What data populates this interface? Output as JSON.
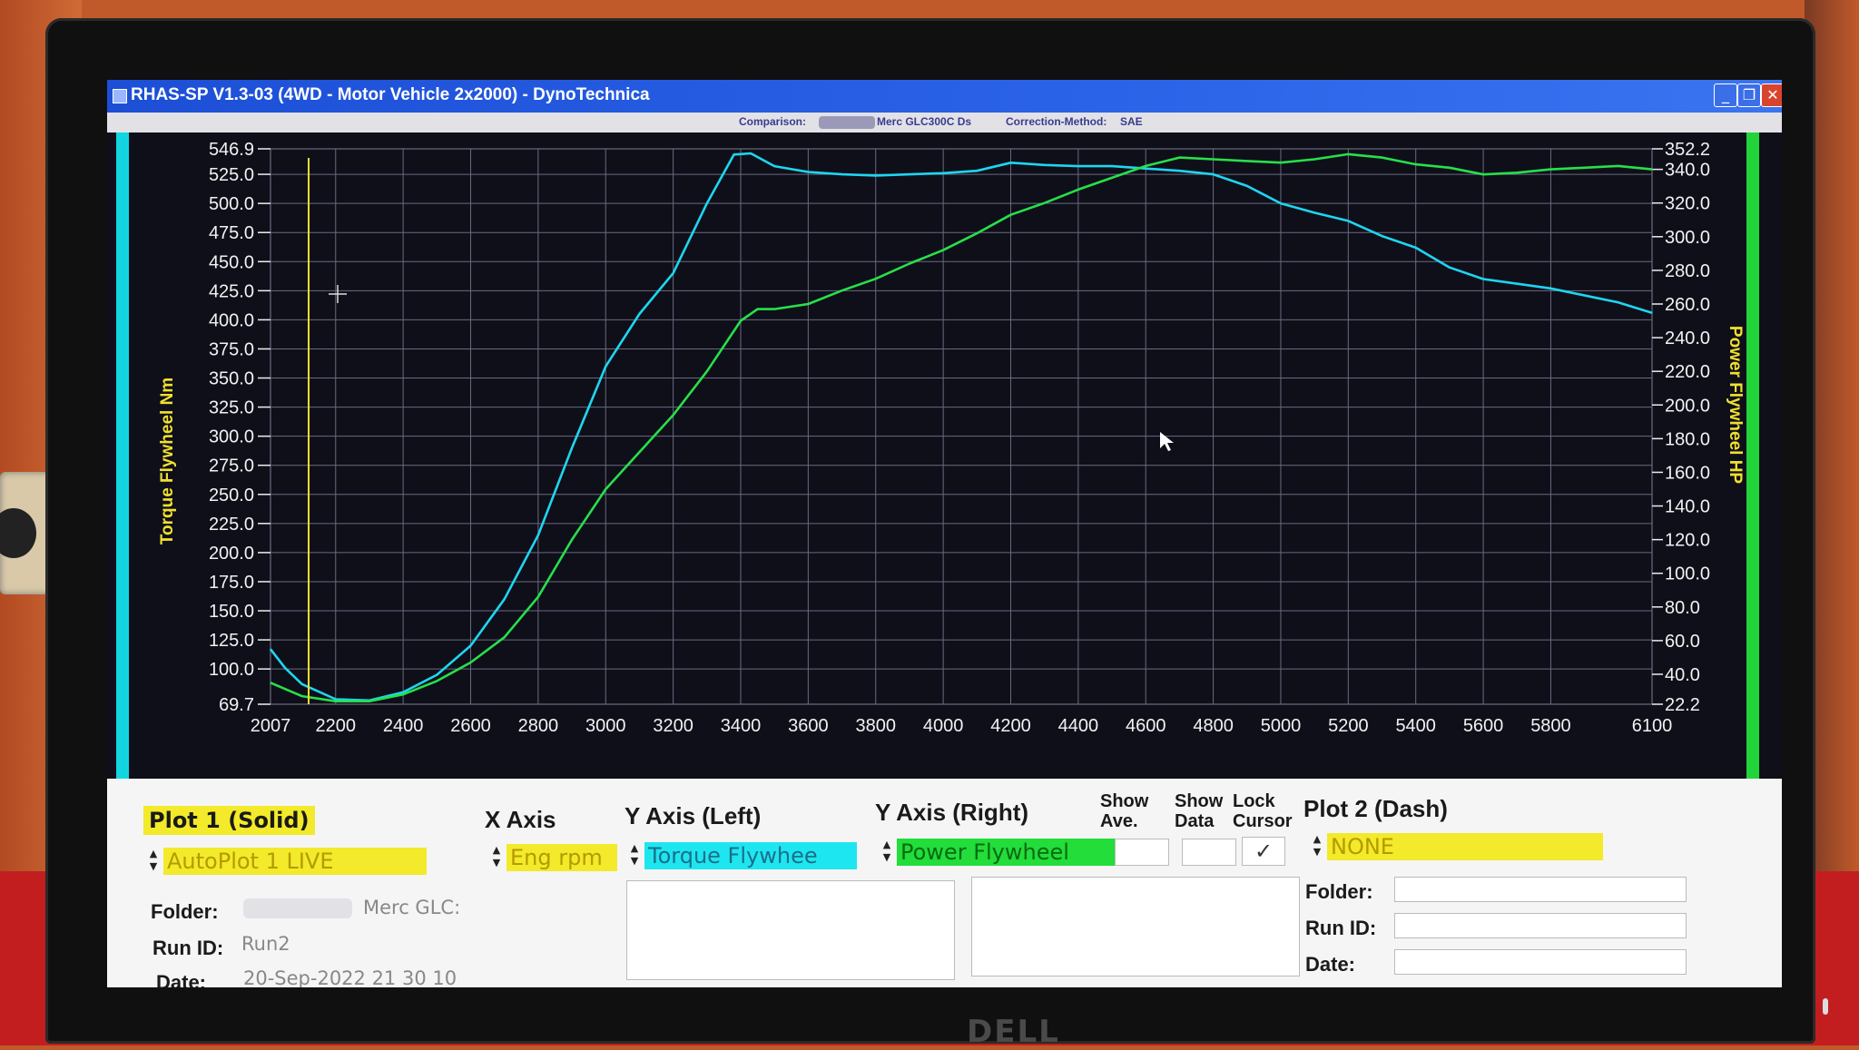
{
  "window": {
    "title": "RHAS-SP V1.3-03  (4WD - Motor Vehicle 2x2000) - DynoTechnica",
    "controls": {
      "minimize": "_",
      "restore": "❐",
      "close": "✕"
    }
  },
  "comparison_bar": {
    "comparison_label": "Comparison:",
    "comparison_value": "Merc GLC300C Ds",
    "correction_label": "Correction-Method:",
    "correction_value": "SAE"
  },
  "monitor": {
    "brand": "DELL"
  },
  "colors": {
    "torque": "#1ed6f0",
    "power": "#27e04a",
    "cursor_line": "#f0e030",
    "grid": "#6a6a80",
    "plot_bg": "#0f0f1a"
  },
  "chart_data": {
    "type": "line",
    "xlabel": "",
    "x_ticks": [
      2007,
      2200,
      2400,
      2600,
      2800,
      3000,
      3200,
      3400,
      3600,
      3800,
      4000,
      4200,
      4400,
      4600,
      4800,
      5000,
      5200,
      5400,
      5600,
      5800,
      6100
    ],
    "x_tick_labels": [
      "2007",
      "2200",
      "2400",
      "2600",
      "2800",
      "3000",
      "3200",
      "3400",
      "3600",
      "3800",
      "4000",
      "4200",
      "4400",
      "4600",
      "4800",
      "5000",
      "5200",
      "5400",
      "5600",
      "5800",
      "6100"
    ],
    "xlim": [
      2007,
      6100
    ],
    "ylabel_left": "Torque Flywheel Nm",
    "ylim_left": [
      69.7,
      546.9
    ],
    "y_left_ticks": [
      "546.9",
      "525.0",
      "500.0",
      "475.0",
      "450.0",
      "425.0",
      "400.0",
      "375.0",
      "350.0",
      "325.0",
      "300.0",
      "275.0",
      "250.0",
      "225.0",
      "200.0",
      "175.0",
      "150.0",
      "125.0",
      "100.0",
      "69.7"
    ],
    "ylabel_right": "Power Flywheel HP",
    "ylim_right": [
      22.2,
      352.2
    ],
    "y_right_ticks": [
      "352.2",
      "340.0",
      "320.0",
      "300.0",
      "280.0",
      "260.0",
      "240.0",
      "220.0",
      "200.0",
      "180.0",
      "160.0",
      "140.0",
      "120.0",
      "100.0",
      "80.0",
      "60.0",
      "40.0",
      "22.2"
    ],
    "grid": true,
    "cursor_rpm": 2120,
    "series": [
      {
        "name": "Torque Flywheel",
        "axis": "left",
        "points": [
          [
            2007,
            117
          ],
          [
            2050,
            101
          ],
          [
            2100,
            87
          ],
          [
            2200,
            74
          ],
          [
            2300,
            73
          ],
          [
            2400,
            80
          ],
          [
            2500,
            95
          ],
          [
            2600,
            120
          ],
          [
            2700,
            160
          ],
          [
            2800,
            215
          ],
          [
            2900,
            290
          ],
          [
            3000,
            360
          ],
          [
            3100,
            405
          ],
          [
            3200,
            440
          ],
          [
            3300,
            500
          ],
          [
            3380,
            542
          ],
          [
            3430,
            543
          ],
          [
            3500,
            532
          ],
          [
            3600,
            527
          ],
          [
            3700,
            525
          ],
          [
            3800,
            524
          ],
          [
            4000,
            526
          ],
          [
            4100,
            528
          ],
          [
            4200,
            535
          ],
          [
            4300,
            533
          ],
          [
            4400,
            532
          ],
          [
            4500,
            532
          ],
          [
            4600,
            530
          ],
          [
            4700,
            528
          ],
          [
            4800,
            525
          ],
          [
            4900,
            515
          ],
          [
            5000,
            500
          ],
          [
            5100,
            492
          ],
          [
            5200,
            485
          ],
          [
            5300,
            472
          ],
          [
            5400,
            462
          ],
          [
            5500,
            445
          ],
          [
            5600,
            435
          ],
          [
            5800,
            427
          ],
          [
            6000,
            415
          ],
          [
            6100,
            406
          ]
        ]
      },
      {
        "name": "Power Flywheel",
        "axis": "right",
        "points": [
          [
            2007,
            35
          ],
          [
            2100,
            27
          ],
          [
            2200,
            24
          ],
          [
            2300,
            24
          ],
          [
            2400,
            28
          ],
          [
            2500,
            36
          ],
          [
            2600,
            47
          ],
          [
            2700,
            62
          ],
          [
            2800,
            86
          ],
          [
            2900,
            120
          ],
          [
            3000,
            150
          ],
          [
            3100,
            172
          ],
          [
            3200,
            194
          ],
          [
            3300,
            220
          ],
          [
            3400,
            250
          ],
          [
            3450,
            257
          ],
          [
            3500,
            257
          ],
          [
            3600,
            260
          ],
          [
            3700,
            268
          ],
          [
            3800,
            275
          ],
          [
            3900,
            284
          ],
          [
            4000,
            292
          ],
          [
            4100,
            302
          ],
          [
            4200,
            313
          ],
          [
            4300,
            320
          ],
          [
            4400,
            328
          ],
          [
            4500,
            335
          ],
          [
            4600,
            342
          ],
          [
            4700,
            347
          ],
          [
            4800,
            346
          ],
          [
            4900,
            345
          ],
          [
            5000,
            344
          ],
          [
            5100,
            346
          ],
          [
            5200,
            349
          ],
          [
            5300,
            347
          ],
          [
            5400,
            343
          ],
          [
            5500,
            341
          ],
          [
            5600,
            337
          ],
          [
            5700,
            338
          ],
          [
            5800,
            340
          ],
          [
            5900,
            341
          ],
          [
            6000,
            342
          ],
          [
            6100,
            340
          ]
        ]
      }
    ]
  },
  "panel": {
    "plot1": {
      "heading": "Plot 1 (Solid)",
      "source": "AutoPlot 1 LIVE",
      "folder_label": "Folder:",
      "folder_value": "Merc GLC:",
      "runid_label": "Run ID:",
      "runid_value": "Run2",
      "date_label": "Date:",
      "date_value": "20-Sep-2022  21 30 10"
    },
    "x_axis": {
      "heading": "X Axis",
      "value": "Eng rpm"
    },
    "y_left": {
      "heading": "Y Axis (Left)",
      "value": "Torque Flywhee"
    },
    "y_right": {
      "heading": "Y Axis (Right)",
      "value": "Power Flywheel"
    },
    "show_ave": {
      "line1": "Show",
      "line2": "Ave."
    },
    "show_data": {
      "line1": "Show",
      "line2": "Data"
    },
    "lock_cursor": {
      "line1": "Lock",
      "line2": "Cursor",
      "checked": "✓"
    },
    "plot2": {
      "heading": "Plot 2 (Dash)",
      "source": "NONE",
      "folder_label": "Folder:",
      "runid_label": "Run ID:",
      "date_label": "Date:"
    }
  }
}
